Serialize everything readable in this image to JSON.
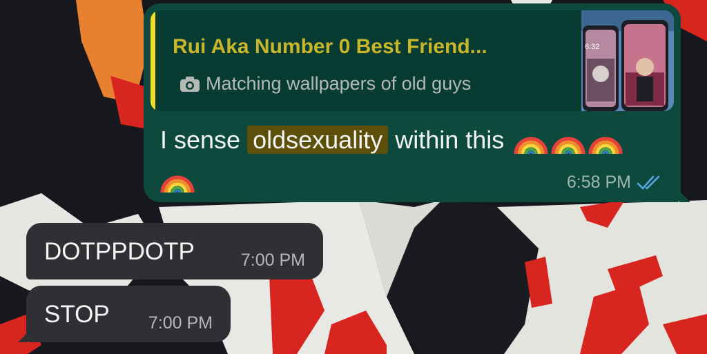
{
  "outgoing": {
    "quote": {
      "author": "Rui Aka Number 0 Best Friend...",
      "subtitle": "Matching wallpapers of old guys",
      "thumb_lockscreen_time": "6:32"
    },
    "text_before": "I sense",
    "highlight": "oldsexuality",
    "text_after": "within this",
    "time": "6:58 PM",
    "status": "read"
  },
  "incoming": [
    {
      "text": "DOTPPDOTP",
      "time": "7:00 PM"
    },
    {
      "text": "STOP",
      "time": "7:00 PM"
    }
  ],
  "colors": {
    "outgoing_bubble": "#0d4a3d",
    "incoming_bubble": "#2f3034",
    "quote_bar": "#f2dc2b",
    "read_ticks": "#5aa8e6"
  }
}
